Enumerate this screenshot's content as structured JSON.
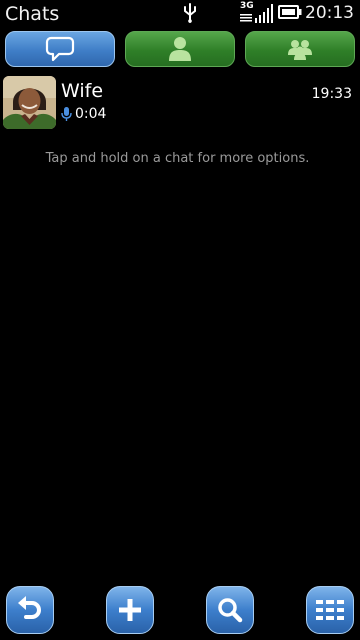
{
  "status_bar": {
    "title": "Chats",
    "network": "3G",
    "time": "20:13",
    "icons": [
      "usb-icon",
      "signal-icon",
      "battery-icon"
    ]
  },
  "tabs": [
    {
      "name": "chats",
      "icon": "chat-bubble-icon",
      "active": true
    },
    {
      "name": "contacts",
      "icon": "person-icon",
      "active": false
    },
    {
      "name": "groups",
      "icon": "group-icon",
      "active": false
    }
  ],
  "chats": [
    {
      "name": "Wife",
      "message_icon": "microphone-icon",
      "duration": "0:04",
      "time": "19:33",
      "avatar": "photo"
    }
  ],
  "hint": "Tap and hold on a chat for more options.",
  "toolbar": {
    "icons": [
      "back-arrow-icon",
      "plus-icon",
      "search-icon",
      "menu-grid-icon"
    ]
  },
  "colors": {
    "accent_blue": "#3f7ec7",
    "accent_green": "#2f7f28",
    "background": "#000000",
    "hint_gray": "#9a9a9a"
  }
}
